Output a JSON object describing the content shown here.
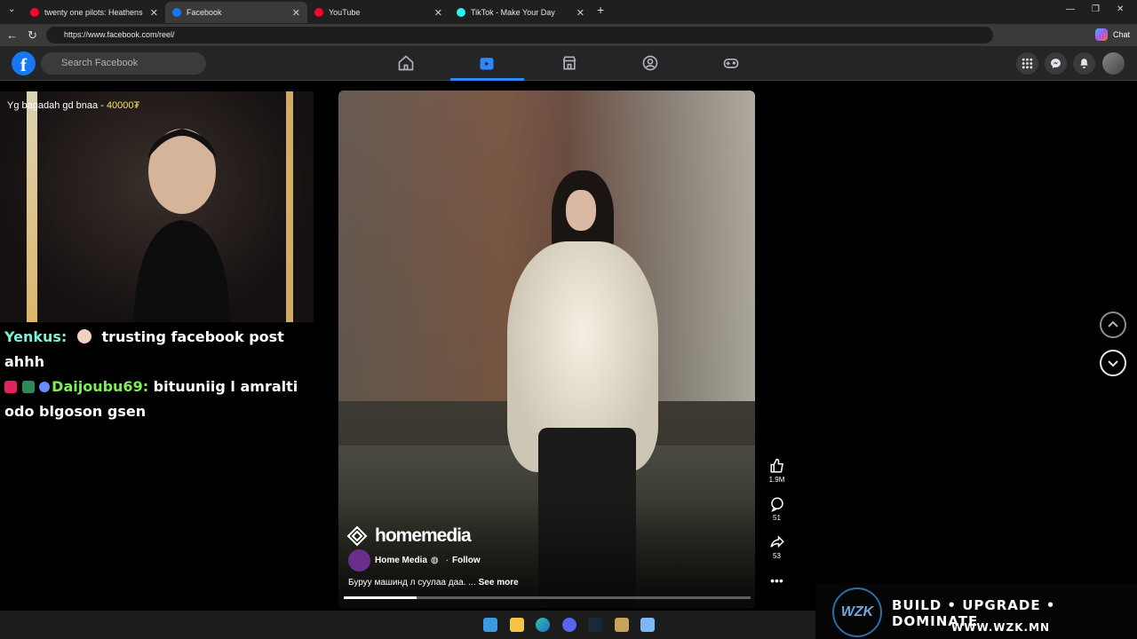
{
  "browser": {
    "tabs": [
      {
        "label": "twenty one pilots: Heathens (from",
        "favicon_color": "#ff0033"
      },
      {
        "label": "Facebook",
        "favicon_color": "#1877f2"
      },
      {
        "label": "YouTube",
        "favicon_color": "#ff0033"
      },
      {
        "label": "TikTok - Make Your Day",
        "favicon_color": "#25f4ee"
      }
    ],
    "new_tab": "+",
    "url": "https://www.facebook.com/reel/",
    "chat_label": "Chat"
  },
  "facebook": {
    "logo": "f",
    "search_placeholder": "Search Facebook",
    "nav_icons": [
      "home-icon",
      "reels-icon",
      "marketplace-icon",
      "groups-icon",
      "gaming-icon"
    ]
  },
  "stream": {
    "donation_text": "Yg bagadah gd bnaa - ",
    "donation_amount": "40000₮",
    "chat": [
      {
        "user": "Yenkus:",
        "message": "trusting facebook post ahhh"
      },
      {
        "user": "Daijoubu69:",
        "message": "bituuniig l amralti odo blgoson gsen"
      }
    ]
  },
  "reel": {
    "watermark": "homemedia",
    "author": "Home Media",
    "follow_label": "Follow",
    "caption": "Буруу машинд л суулаа даа. ...",
    "see_more": "See more",
    "progress": 0.18,
    "likes": "1.9M",
    "comments": "51",
    "shares": "53"
  },
  "promo": {
    "logo": "WZK",
    "tagline": "BUILD • UPGRADE • DOMINATE",
    "url": "WWW.WZK.MN"
  }
}
